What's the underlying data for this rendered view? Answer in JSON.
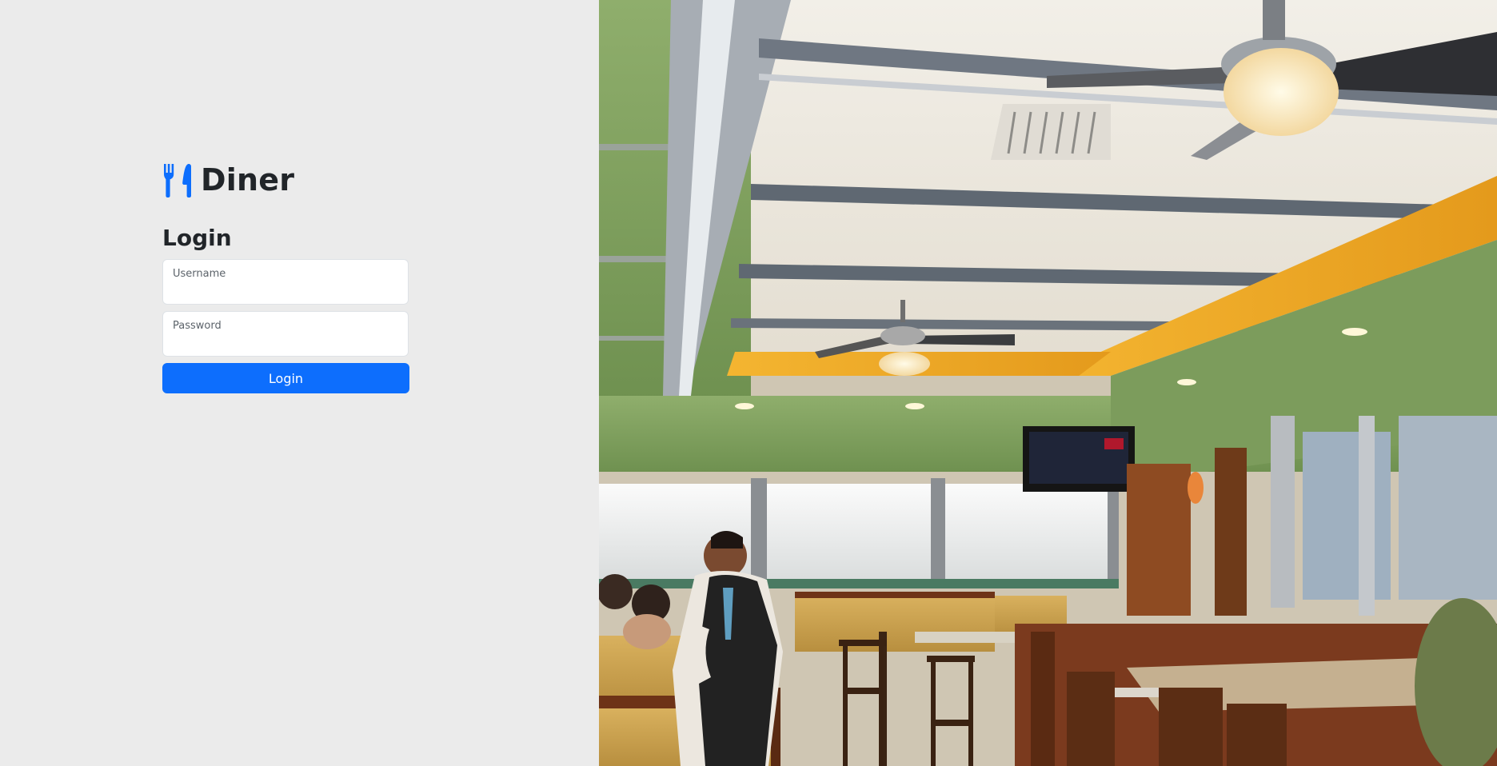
{
  "brand": {
    "name": "Diner",
    "icon": "utensils-icon",
    "icon_color": "#0d6efd"
  },
  "login": {
    "heading": "Login",
    "username_label": "Username",
    "username_value": "",
    "password_label": "Password",
    "password_value": "",
    "button_label": "Login"
  },
  "hero": {
    "image": "diner-interior-photo"
  },
  "colors": {
    "background": "#ebebeb",
    "primary": "#0d6efd",
    "text": "#212529"
  }
}
